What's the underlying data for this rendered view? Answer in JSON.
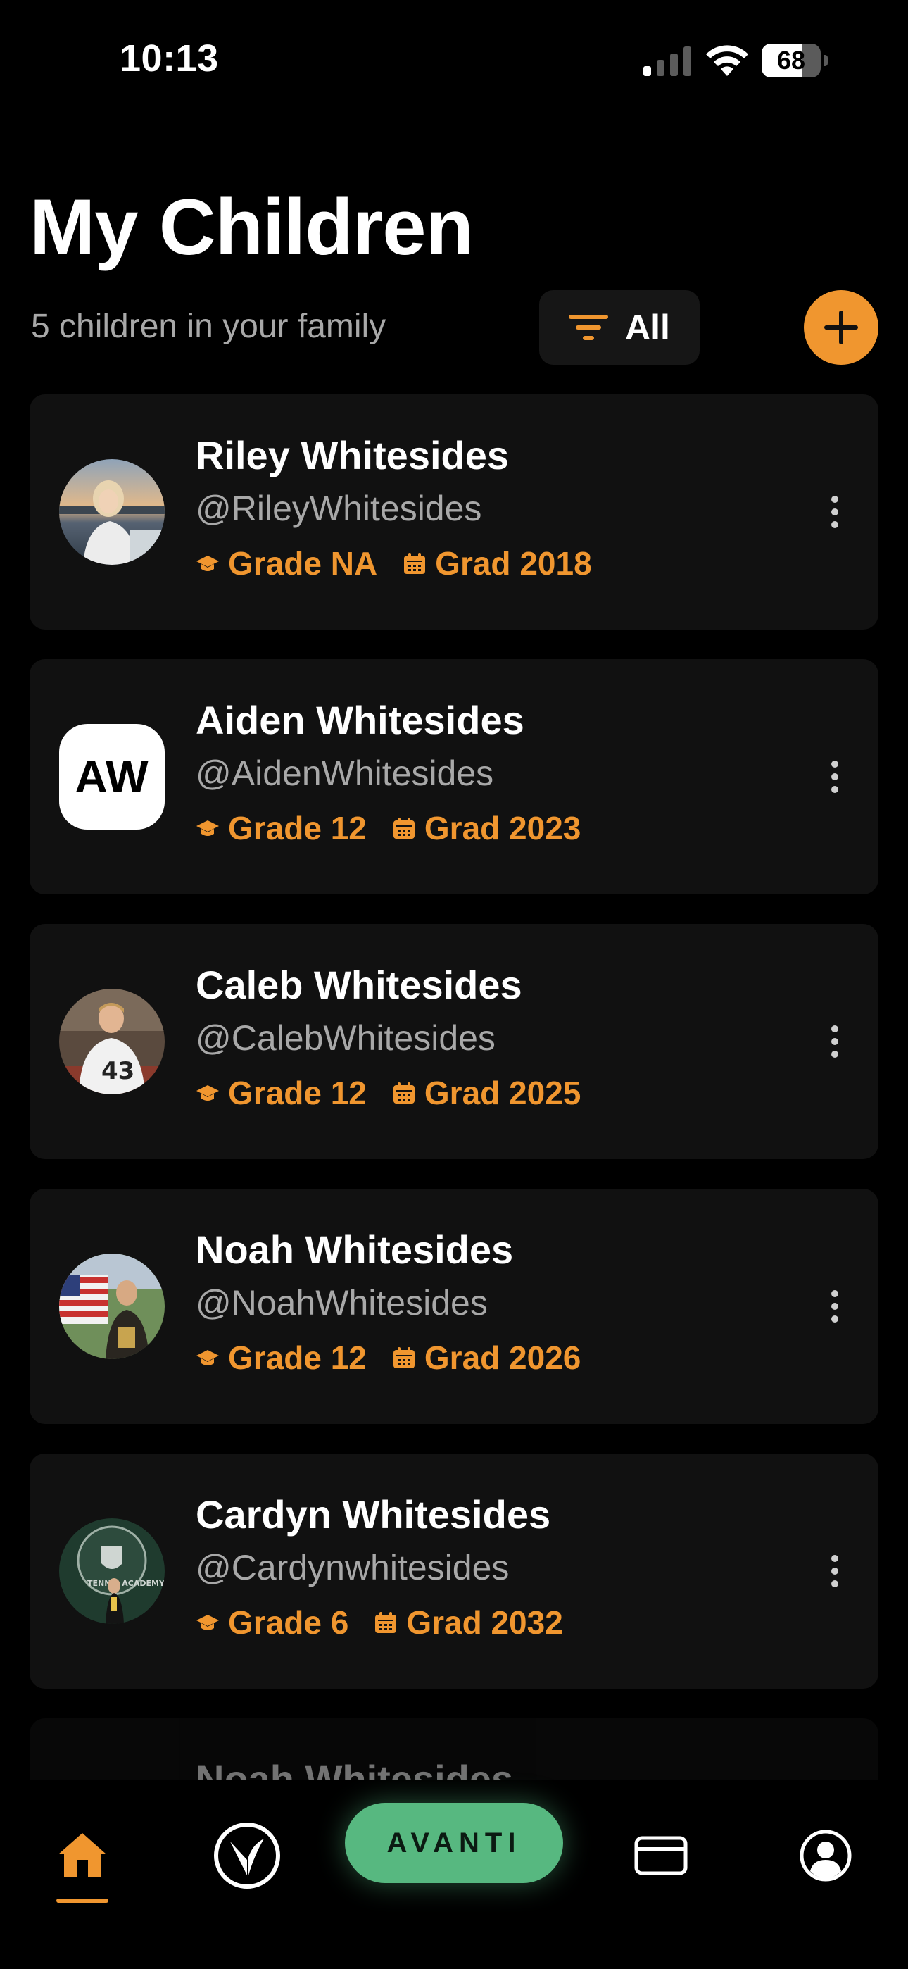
{
  "status_bar": {
    "time": "10:13",
    "battery": "68",
    "battery_level": 0.68,
    "signal_icon": "cellular-signal-icon",
    "wifi_icon": "wifi-icon"
  },
  "header": {
    "title": "My Children",
    "subtitle": "5 children in your family",
    "filter_label": "All",
    "filter_icon": "filter-icon",
    "add_icon": "plus-icon"
  },
  "children": [
    {
      "name": "Riley Whitesides",
      "handle": "@RileyWhitesides",
      "grade": "Grade NA",
      "grad": "Grad 2018",
      "avatar": "photo"
    },
    {
      "name": "Aiden Whitesides",
      "handle": "@AidenWhitesides",
      "grade": "Grade 12",
      "grad": "Grad 2023",
      "avatar": "initials",
      "initials": "AW"
    },
    {
      "name": "Caleb Whitesides",
      "handle": "@CalebWhitesides",
      "grade": "Grade 12",
      "grad": "Grad 2025",
      "avatar": "photo"
    },
    {
      "name": "Noah Whitesides",
      "handle": "@NoahWhitesides",
      "grade": "Grade 12",
      "grad": "Grad 2026",
      "avatar": "photo"
    },
    {
      "name": "Cardyn Whitesides",
      "handle": "@Cardynwhitesides",
      "grade": "Grade 6",
      "grad": "Grad 2032",
      "avatar": "photo"
    },
    {
      "name": "Noah Whitesides",
      "avatar": "photo"
    }
  ],
  "tab_bar": {
    "items": [
      {
        "name": "home",
        "icon": "home-icon",
        "active": true
      },
      {
        "name": "avanti-logo",
        "icon": "v-logo-icon",
        "active": false
      },
      {
        "name": "avanti",
        "label": "AVANTI",
        "active": false
      },
      {
        "name": "card",
        "icon": "credit-card-icon",
        "active": false
      },
      {
        "name": "profile",
        "icon": "profile-icon",
        "active": false
      }
    ]
  },
  "colors": {
    "background": "#000000",
    "card": "#111111",
    "accent": "#F0962F",
    "avanti_green": "#57B880",
    "muted_text": "#a8a8a8"
  }
}
